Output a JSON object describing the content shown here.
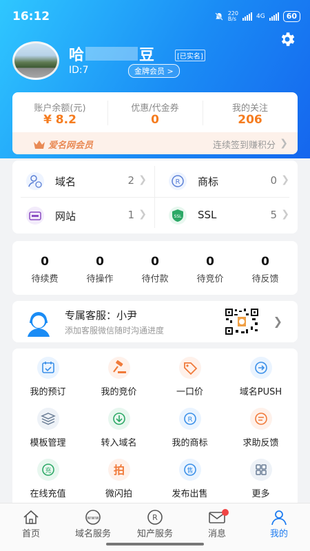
{
  "status": {
    "time": "16:12",
    "net_speed": "220\nB/s",
    "net_type": "4G",
    "battery": "60"
  },
  "profile": {
    "name_prefix": "哈",
    "name_suffix": "豆",
    "verified": "[已实名]",
    "id_label": "ID:7",
    "vip_label": "金牌会员 >"
  },
  "stats": [
    {
      "label": "账户余额(元)",
      "value": "¥ 8.2"
    },
    {
      "label": "优惠/代金券",
      "value": "0"
    },
    {
      "label": "我的关注",
      "value": "206"
    }
  ],
  "member": {
    "brand": "爱名网会员",
    "sign_text": "连续签到赚积分"
  },
  "services": [
    {
      "name": "域名",
      "count": "2",
      "icon": "user-domain-icon"
    },
    {
      "name": "商标",
      "count": "0",
      "icon": "trademark-r-icon"
    },
    {
      "name": "网站",
      "count": "1",
      "icon": "www-icon"
    },
    {
      "name": "SSL",
      "count": "5",
      "icon": "ssl-shield-icon"
    }
  ],
  "orders": [
    {
      "count": "0",
      "label": "待续费"
    },
    {
      "count": "0",
      "label": "待操作"
    },
    {
      "count": "0",
      "label": "待付款"
    },
    {
      "count": "0",
      "label": "待竞价"
    },
    {
      "count": "0",
      "label": "待反馈"
    }
  ],
  "kefu": {
    "title": "专属客服：小尹",
    "subtitle": "添加客服微信随时沟通进度"
  },
  "grid": [
    {
      "label": "我的预订",
      "icon": "calendar-icon"
    },
    {
      "label": "我的竞价",
      "icon": "auction-icon"
    },
    {
      "label": "一口价",
      "icon": "price-tag-icon"
    },
    {
      "label": "域名PUSH",
      "icon": "push-icon"
    },
    {
      "label": "模板管理",
      "icon": "layers-icon"
    },
    {
      "label": "转入域名",
      "icon": "transfer-icon"
    },
    {
      "label": "我的商标",
      "icon": "trademark-icon"
    },
    {
      "label": "求助反馈",
      "icon": "feedback-icon"
    },
    {
      "label": "在线充值",
      "icon": "recharge-icon"
    },
    {
      "label": "微闪拍",
      "icon": "flash-auction-icon"
    },
    {
      "label": "发布出售",
      "icon": "sell-icon"
    },
    {
      "label": "更多",
      "icon": "more-grid-icon"
    }
  ],
  "tabs": [
    {
      "label": "首页",
      "icon": "home-icon"
    },
    {
      "label": "域名服务",
      "icon": "www-icon"
    },
    {
      "label": "知产服务",
      "icon": "trademark-icon"
    },
    {
      "label": "消息",
      "icon": "mail-icon"
    },
    {
      "label": "我的",
      "icon": "person-icon"
    }
  ],
  "colors": {
    "accent": "#1e7cf0",
    "orange": "#f57c1f",
    "hero_start": "#2fc7ff",
    "hero_end": "#1566ee"
  }
}
